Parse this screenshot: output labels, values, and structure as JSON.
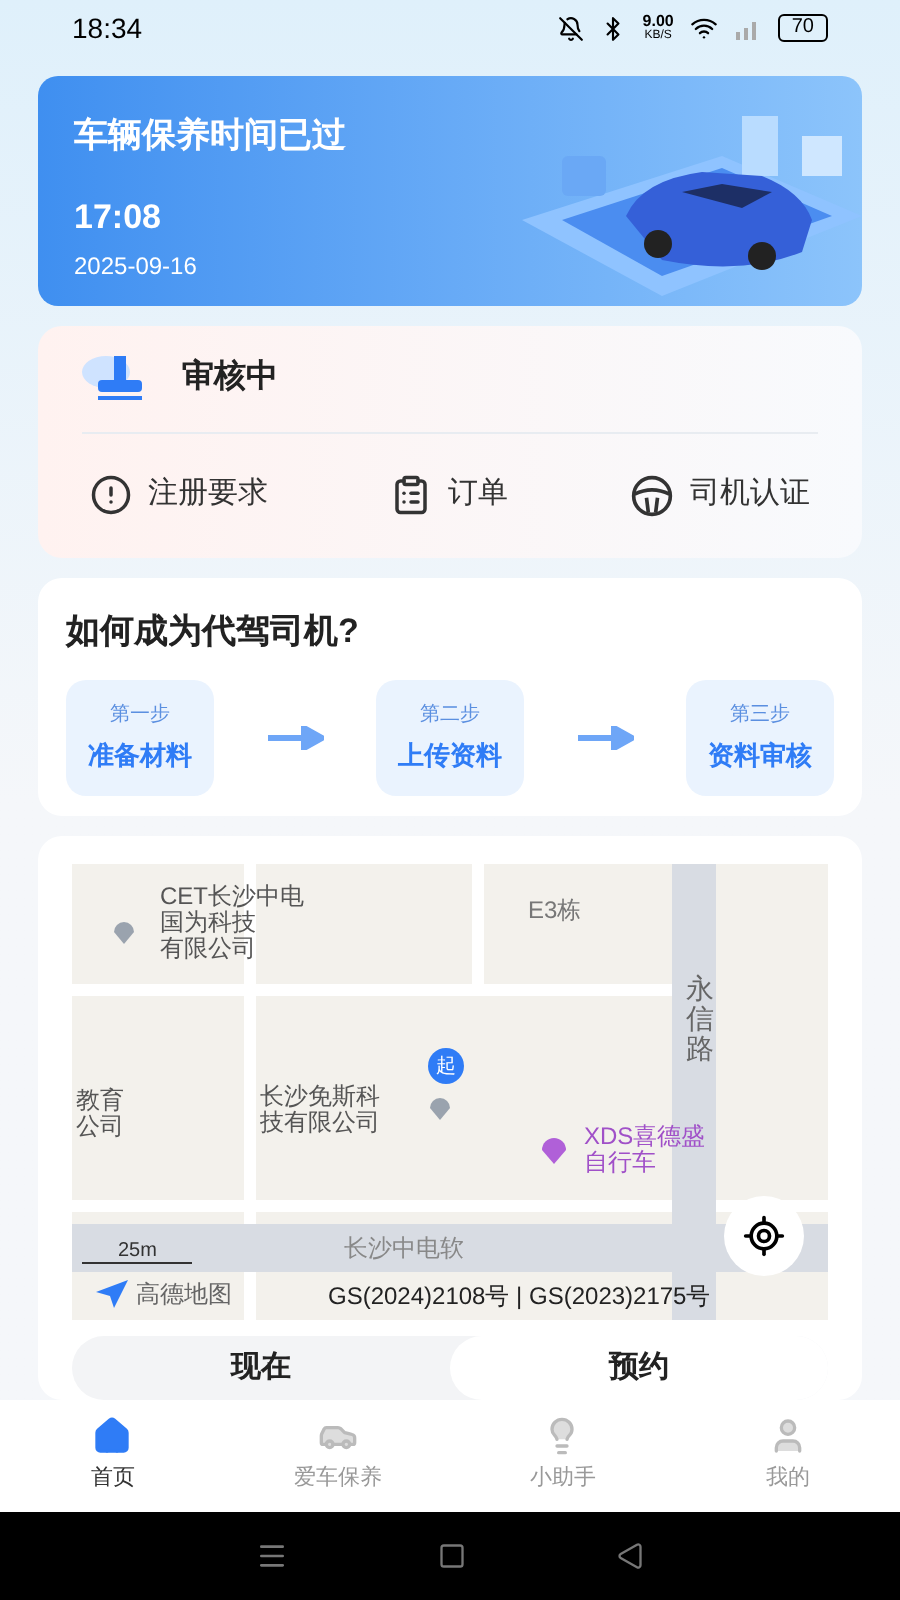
{
  "status_bar": {
    "time": "18:34",
    "speed": "9.00",
    "speed_unit": "KB/S",
    "battery": "70"
  },
  "banner": {
    "title": "车辆保养时间已过",
    "time": "17:08",
    "date": "2025-09-16"
  },
  "review": {
    "status": "审核中",
    "actions": [
      {
        "kind": "alert",
        "label": "注册要求"
      },
      {
        "kind": "clipboard",
        "label": "订单"
      },
      {
        "kind": "wheel",
        "label": "司机认证"
      }
    ]
  },
  "steps": {
    "title": "如何成为代驾司机?",
    "items": [
      {
        "step": "第一步",
        "label": "准备材料"
      },
      {
        "step": "第二步",
        "label": "上传资料"
      },
      {
        "step": "第三步",
        "label": "资料审核"
      }
    ]
  },
  "map": {
    "labels": [
      [
        "CET长沙中电",
        "国为科技",
        "有限公司"
      ],
      [
        "E3栋"
      ],
      [
        "永信路"
      ],
      [
        "教育",
        "公司"
      ],
      [
        "长沙免斯科",
        "技有限公司"
      ],
      [
        "XDS喜德盛",
        "自行车"
      ],
      [
        "长沙中电软"
      ]
    ],
    "start_marker": "起",
    "scale": "25m",
    "brand": "高德地图",
    "license": "GS(2024)2108号 | GS(2023)2175号"
  },
  "mode_tabs": [
    {
      "label": "现在",
      "selected": false
    },
    {
      "label": "预约",
      "selected": true
    }
  ],
  "tab_bar": [
    {
      "kind": "home",
      "label": "首页",
      "selected": true
    },
    {
      "kind": "car",
      "label": "爱车保养",
      "selected": false
    },
    {
      "kind": "bulb",
      "label": "小助手",
      "selected": false
    },
    {
      "kind": "user",
      "label": "我的",
      "selected": false
    }
  ]
}
